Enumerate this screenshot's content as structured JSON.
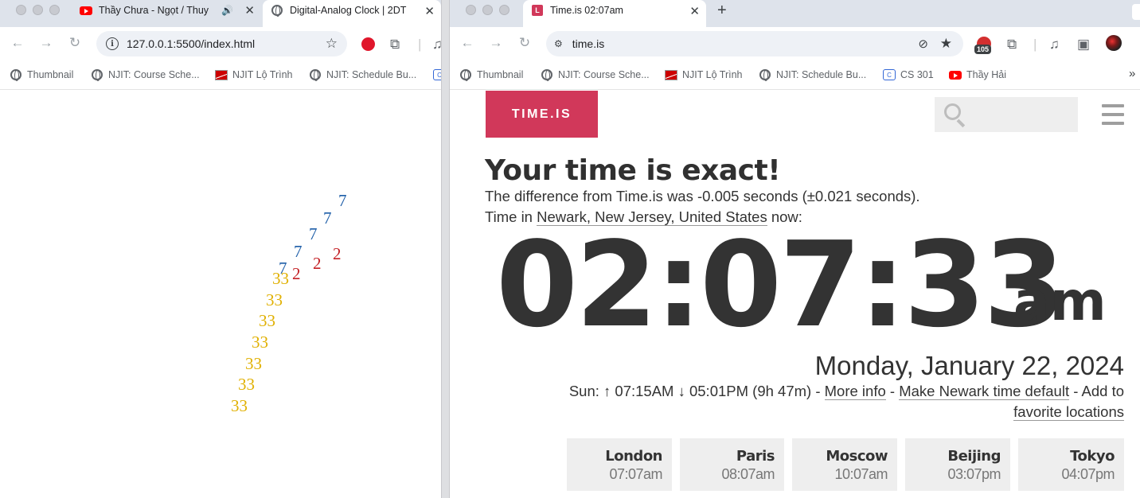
{
  "left": {
    "tabs": [
      {
        "title": "Thầy Chưa - Ngọt / Thuy",
        "icon": "youtube-icon",
        "audio_icon": "🔊"
      },
      {
        "title": "Digital-Analog Clock | 2DT",
        "icon": "globe-icon"
      }
    ],
    "url": "127.0.0.1:5500/index.html",
    "bookmarks": [
      "Thumbnail",
      "NJIT: Course Sche...",
      "NJIT Lộ Trình",
      "NJIT: Schedule Bu..."
    ],
    "clock_digits": {
      "hours": [
        "7",
        "7",
        "7",
        "7",
        "7"
      ],
      "minutes": [
        "2",
        "2",
        "2"
      ],
      "seconds": [
        "33",
        "33",
        "33",
        "33",
        "33",
        "33",
        "33"
      ]
    }
  },
  "right": {
    "tab": {
      "title": "Time.is 02:07am",
      "icon": "timeis-icon"
    },
    "url": "time.is",
    "badge": "105",
    "bookmarks": [
      "Thumbnail",
      "NJIT: Course Sche...",
      "NJIT Lộ Trình",
      "NJIT: Schedule Bu...",
      "CS 301",
      "Thầy Hải"
    ],
    "logo": "TIME.IS",
    "headline": "Your time is exact!",
    "difference": "The difference from Time.is was -0.005 seconds (±0.021 seconds).",
    "time_in_prefix": "Time in",
    "location": "Newark, New Jersey, United States",
    "time_in_suffix": "now:",
    "clock": "02:07:33",
    "ampm": "am",
    "date": "Monday, January 22, 2024",
    "sun_prefix": "Sun: ↑ 07:15AM ↓ 05:01PM (9h 47m) -",
    "more_info": "More info",
    "sep1": "-",
    "make_default": "Make Newark time default",
    "sep2": "- Add to",
    "favorites": "favorite locations",
    "cities": [
      {
        "name": "London",
        "time": "07:07am"
      },
      {
        "name": "Paris",
        "time": "08:07am"
      },
      {
        "name": "Moscow",
        "time": "10:07am"
      },
      {
        "name": "Beijing",
        "time": "03:07pm"
      },
      {
        "name": "Tokyo",
        "time": "04:07pm"
      }
    ]
  }
}
